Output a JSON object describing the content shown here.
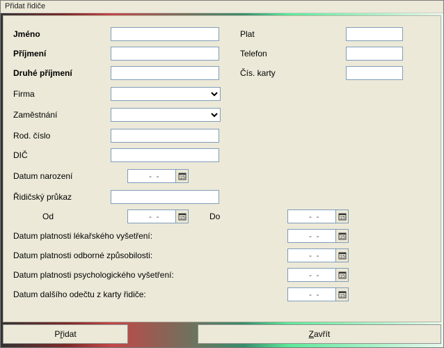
{
  "window": {
    "title": "Přidat řidiče"
  },
  "fields": {
    "jmeno": {
      "label": "Jméno",
      "value": ""
    },
    "prijmeni": {
      "label": "Příjmení",
      "value": ""
    },
    "druhe_prijmeni": {
      "label": "Druhé příjmení",
      "value": ""
    },
    "firma": {
      "label": "Firma",
      "value": ""
    },
    "zamestnani": {
      "label": "Zaměstnání",
      "value": ""
    },
    "rod_cislo": {
      "label": "Rod. číslo",
      "value": ""
    },
    "dic": {
      "label": "DIČ",
      "value": ""
    },
    "datum_narozeni": {
      "label": "Datum narození",
      "value": "  -  -"
    },
    "ridicsky_prukaz": {
      "label": "Řidičský průkaz",
      "value": ""
    },
    "od": {
      "label": "Od",
      "value": "  -  -"
    },
    "do": {
      "label": "Do",
      "value": "  -  -"
    },
    "lekarske": {
      "label": "Datum platnosti lékařského vyšetření:",
      "value": "  -  -"
    },
    "odborne": {
      "label": "Datum platnosti odborné způsobilosti:",
      "value": "  -  -"
    },
    "psych": {
      "label": "Datum platnosti psychologického vyšetření:",
      "value": "  -  -"
    },
    "odectu": {
      "label": "Datum dalšího odečtu z karty řidiče:",
      "value": "  -  -"
    },
    "plat": {
      "label": "Plat",
      "value": ""
    },
    "telefon": {
      "label": "Telefon",
      "value": ""
    },
    "cis_karty": {
      "label": "Čís. karty",
      "value": ""
    }
  },
  "buttons": {
    "pridat_prefix": "P",
    "pridat_underline": "ř",
    "pridat_suffix": "idat",
    "zavrit_prefix": "",
    "zavrit_underline": "Z",
    "zavrit_suffix": "avřít"
  }
}
